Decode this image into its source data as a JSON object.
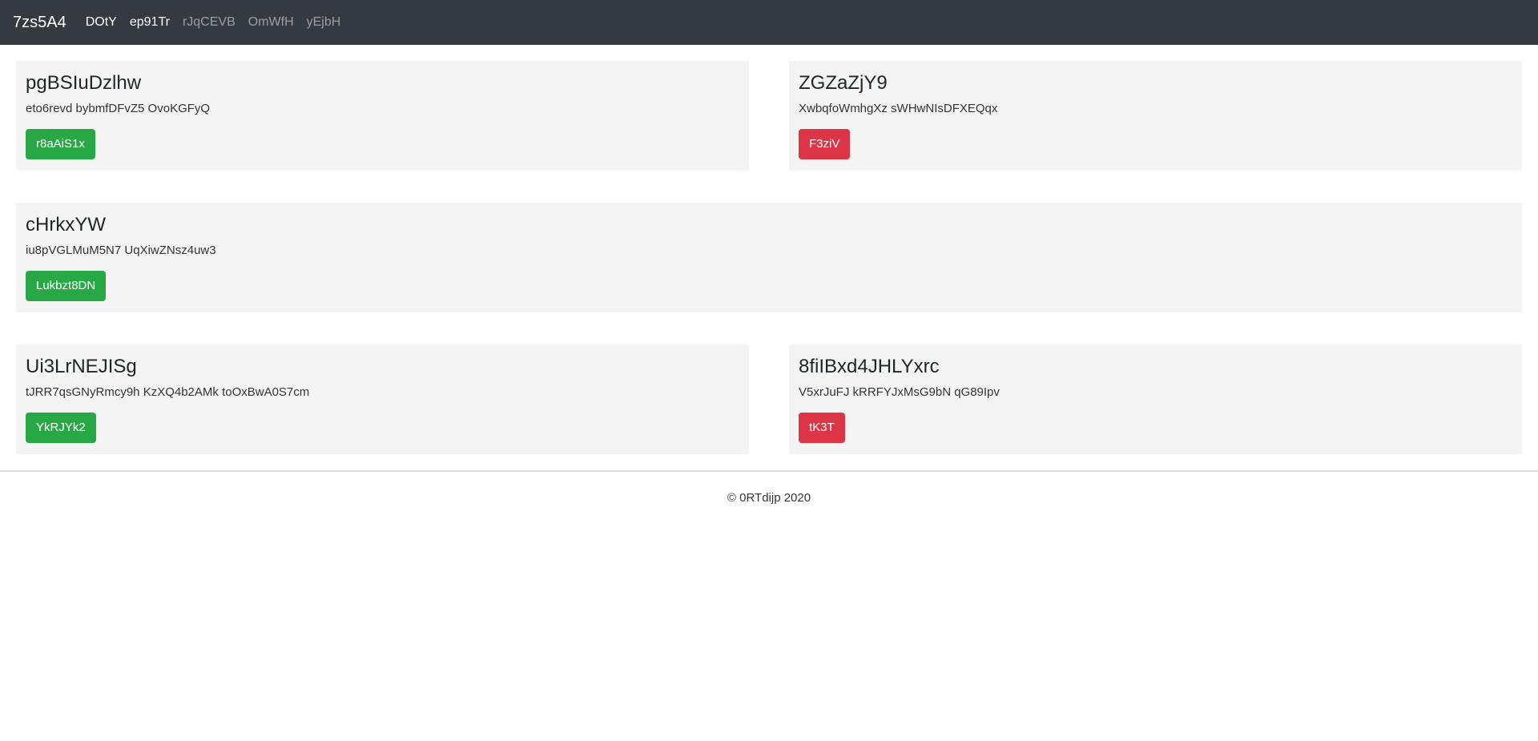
{
  "navbar": {
    "brand": "7zs5A4",
    "links": [
      {
        "label": "DOtY",
        "active": true
      },
      {
        "label": "ep91Tr",
        "active": true
      },
      {
        "label": "rJqCEVB",
        "active": false
      },
      {
        "label": "OmWfH",
        "active": false
      },
      {
        "label": "yEjbH",
        "active": false
      }
    ]
  },
  "cards": [
    {
      "title": "pgBSIuDzlhw",
      "text": "eto6revd bybmfDFvZ5 OvoKGFyQ",
      "button": "r8aAiS1x",
      "button_style": "success"
    },
    {
      "title": "ZGZaZjY9",
      "text": "XwbqfoWmhgXz sWHwNIsDFXEQqx",
      "button": "F3ziV",
      "button_style": "danger"
    },
    {
      "title": "cHrkxYW",
      "text": "iu8pVGLMuM5N7 UqXiwZNsz4uw3",
      "button": "Lukbzt8DN",
      "button_style": "success"
    },
    {
      "title": "Ui3LrNEJISg",
      "text": "tJRR7qsGNyRmcy9h KzXQ4b2AMk toOxBwA0S7cm",
      "button": "YkRJYk2",
      "button_style": "success"
    },
    {
      "title": "8fiIBxd4JHLYxrc",
      "text": "V5xrJuFJ kRRFYJxMsG9bN qG89Ipv",
      "button": "tK3T",
      "button_style": "danger"
    }
  ],
  "footer": {
    "text": "© 0RTdijp 2020"
  },
  "colors": {
    "navbar_bg": "#343a40",
    "card_bg": "#f4f4f4",
    "success": "#28a745",
    "danger": "#dc3545"
  }
}
